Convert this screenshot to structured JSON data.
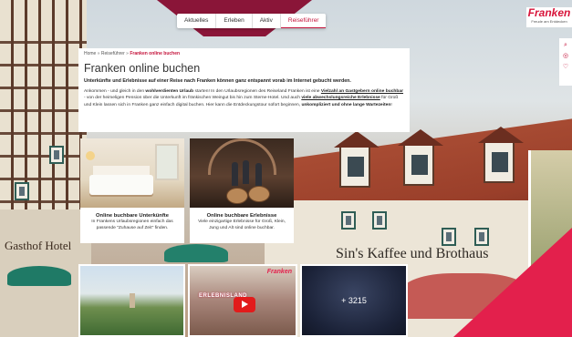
{
  "nav": {
    "items": [
      {
        "label": "Aktuelles"
      },
      {
        "label": "Erleben"
      },
      {
        "label": "Aktiv"
      },
      {
        "label": "Reiseführer"
      }
    ],
    "active_index": 3
  },
  "logo": {
    "brand": "Franken",
    "tagline": "Freude am Entdecken"
  },
  "breadcrumb": {
    "home": "Home",
    "separator": "»",
    "parent": "Reiseführer",
    "current": "Franken online buchen"
  },
  "content": {
    "title": "Franken online buchen",
    "lead": "Unterkünfte und Erlebnisse auf einer Reise nach Franken können ganz entspannt vorab im Internet gebucht werden.",
    "body": {
      "p1": "Ankommen - und gleich in den ",
      "b1": "wohlverdienten Urlaub",
      "p2": " starten! In den Urlaubsregionen des Reiseland Franken ist eine ",
      "link1": "Vielzahl an Gastgebern online buchbar",
      "p3": " - von der heimeligen Pension über die Unterkunft im fränkischen Weingut bis hin zum Sterne-Hotel. Und auch ",
      "link2": "viele abwechslungsreiche Erlebnisse",
      "p4": " für Groß und Klein lassen sich in Franken ganz einfach digital buchen. Hier kann die Entdeckungstour sofort beginnen, ",
      "b2": "unkompliziert und ohne lange Wartezeiten",
      "p5": "!"
    }
  },
  "tiles": [
    {
      "title": "Online buchbare Unterkünfte",
      "text": "In Frankens Urlaubsregionen einfach das passende \"Zuhause auf Zeit\" finden."
    },
    {
      "title": "Online buchbare Erlebnisse",
      "text": "Viele einzigartige Erlebnisse für Groß, Klein, Jung und Alt sind online buchbar."
    }
  ],
  "background": {
    "sign_left": "Gasthof Hotel",
    "sign_right": "Sin's Kaffee und Brothaus"
  },
  "media": {
    "video_logo": "Franken",
    "video_text": "ERLEBNISLAND",
    "gallery_count": "+ 3215"
  },
  "colors": {
    "accent": "#c4123a",
    "nav_wedge": "#8a1538",
    "pink_corner": "#e3204c"
  }
}
